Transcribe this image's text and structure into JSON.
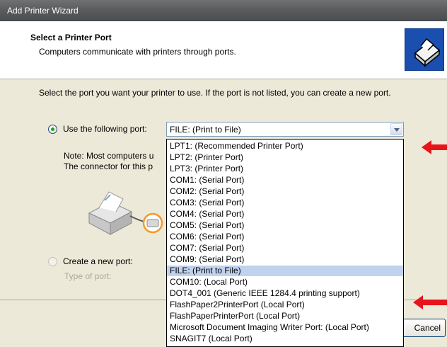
{
  "window": {
    "title": "Add Printer Wizard"
  },
  "header": {
    "title": "Select a Printer Port",
    "subtitle": "Computers communicate with printers through ports."
  },
  "instructions": "Select the port you want your printer to use.  If the port is not listed, you can create a new port.",
  "use_port": {
    "label": "Use the following port:",
    "selected": "FILE: (Print to File)"
  },
  "note": {
    "line1": "Note: Most computers u",
    "line2": "The connector for this p"
  },
  "dropdown": {
    "options": [
      "LPT1: (Recommended Printer Port)",
      "LPT2: (Printer Port)",
      "LPT3: (Printer Port)",
      "COM1: (Serial Port)",
      "COM2: (Serial Port)",
      "COM3: (Serial Port)",
      "COM4: (Serial Port)",
      "COM5: (Serial Port)",
      "COM6: (Serial Port)",
      "COM7: (Serial Port)",
      "COM9: (Serial Port)",
      "FILE: (Print to File)",
      "COM10: (Local Port)",
      "DOT4_001 (Generic IEEE 1284.4 printing support)",
      "FlashPaper2PrinterPort (Local Port)",
      "FlashPaperPrinterPort (Local Port)",
      "Microsoft Document Imaging Writer Port: (Local Port)",
      "SNAGIT7 (Local Port)"
    ],
    "selected_index": 11
  },
  "create_port": {
    "label": "Create a new port:",
    "type_label": "Type of port:"
  },
  "buttons": {
    "cancel": "Cancel"
  },
  "colors": {
    "arrow": "#e8141c",
    "selection": "#c1d2ee",
    "header_icon": "#1a4fb0"
  },
  "icons": [
    "printer-port-icon",
    "printer-illustration-icon",
    "red-arrow-icon"
  ]
}
